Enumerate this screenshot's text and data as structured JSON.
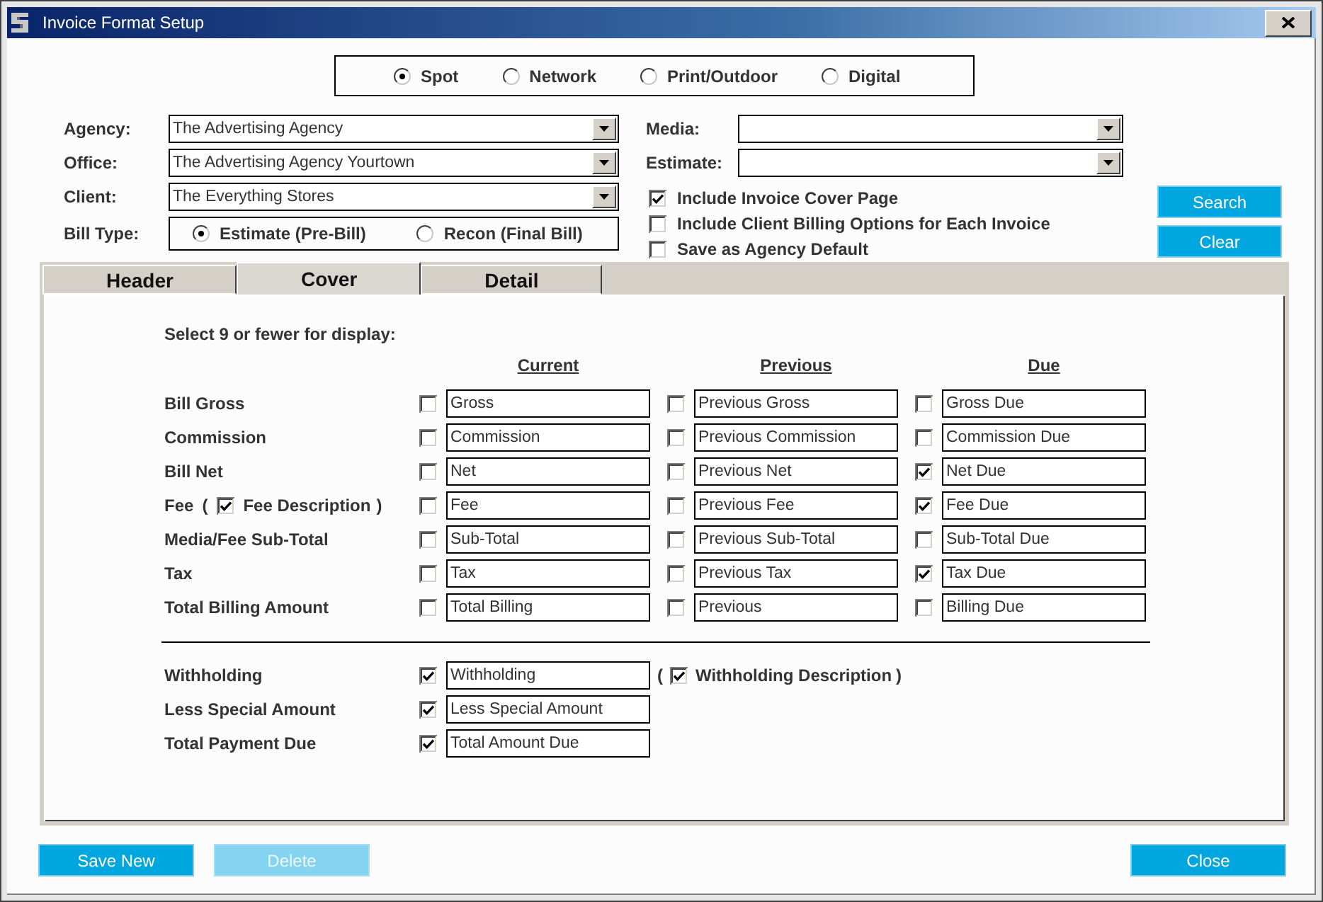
{
  "window": {
    "title": "Invoice Format Setup"
  },
  "media_types": [
    {
      "label": "Spot",
      "selected": true
    },
    {
      "label": "Network",
      "selected": false
    },
    {
      "label": "Print/Outdoor",
      "selected": false
    },
    {
      "label": "Digital",
      "selected": false
    }
  ],
  "selectors": [
    {
      "label": "Agency:",
      "value": "The Advertising Agency"
    },
    {
      "label": "Office:",
      "value": "The Advertising Agency Yourtown"
    },
    {
      "label": "Client:",
      "value": "The Everything Stores"
    }
  ],
  "bill_type": {
    "label": "Bill Type:",
    "options": [
      {
        "label": "Estimate (Pre-Bill)",
        "selected": true
      },
      {
        "label": "Recon (Final Bill)",
        "selected": false
      }
    ]
  },
  "filters": [
    {
      "label": "Media:"
    },
    {
      "label": "Estimate:"
    }
  ],
  "options": [
    {
      "label": "Include Invoice Cover Page",
      "checked": true
    },
    {
      "label": "Include Client Billing Options for Each Invoice",
      "checked": false
    },
    {
      "label": "Save as Agency Default",
      "checked": false
    }
  ],
  "search_buttons": [
    "Search",
    "Clear"
  ],
  "tabs": [
    {
      "label": "Header",
      "selected": false
    },
    {
      "label": "Cover",
      "selected": true
    },
    {
      "label": "Detail",
      "selected": false
    }
  ],
  "cover": {
    "instruction": "Select 9 or fewer for display:",
    "columns": [
      "Current",
      "Previous",
      "Due"
    ],
    "rows": [
      {
        "label": "Bill Gross",
        "cells": [
          {
            "checked": false,
            "value": "Gross"
          },
          {
            "checked": false,
            "value": "Previous Gross"
          },
          {
            "checked": false,
            "value": "Gross Due"
          }
        ]
      },
      {
        "label": "Commission",
        "cells": [
          {
            "checked": false,
            "value": "Commission"
          },
          {
            "checked": false,
            "value": "Previous Commission"
          },
          {
            "checked": false,
            "value": "Commission Due"
          }
        ]
      },
      {
        "label": "Bill Net",
        "cells": [
          {
            "checked": false,
            "value": "Net"
          },
          {
            "checked": false,
            "value": "Previous Net"
          },
          {
            "checked": true,
            "value": "Net Due"
          }
        ]
      },
      {
        "label": "Fee",
        "description": {
          "open": "(",
          "checked": true,
          "label": "Fee Description",
          "close": ")"
        },
        "cells": [
          {
            "checked": false,
            "value": "Fee"
          },
          {
            "checked": false,
            "value": "Previous Fee"
          },
          {
            "checked": true,
            "value": "Fee Due"
          }
        ]
      },
      {
        "label": "Media/Fee Sub-Total",
        "cells": [
          {
            "checked": false,
            "value": "Sub-Total"
          },
          {
            "checked": false,
            "value": "Previous Sub-Total"
          },
          {
            "checked": false,
            "value": "Sub-Total Due"
          }
        ]
      },
      {
        "label": "Tax",
        "cells": [
          {
            "checked": false,
            "value": "Tax"
          },
          {
            "checked": false,
            "value": "Previous Tax"
          },
          {
            "checked": true,
            "value": "Tax Due"
          }
        ]
      },
      {
        "label": "Total Billing Amount",
        "cells": [
          {
            "checked": false,
            "value": "Total Billing"
          },
          {
            "checked": false,
            "value": "Previous"
          },
          {
            "checked": false,
            "value": "Billing Due"
          }
        ]
      }
    ],
    "deductions": [
      {
        "label": "Withholding",
        "checked": true,
        "value": "Withholding",
        "description": {
          "open": "(",
          "checked": true,
          "label": "Withholding Description",
          "close": ")"
        }
      },
      {
        "label": "Less Special Amount",
        "checked": true,
        "value": "Less Special Amount"
      },
      {
        "label": "Total Payment Due",
        "checked": true,
        "value": "Total Amount Due"
      }
    ]
  },
  "footer_buttons": [
    {
      "label": "Save New",
      "disabled": false
    },
    {
      "label": "Delete",
      "disabled": true
    },
    {
      "label": "Close",
      "disabled": false
    }
  ]
}
